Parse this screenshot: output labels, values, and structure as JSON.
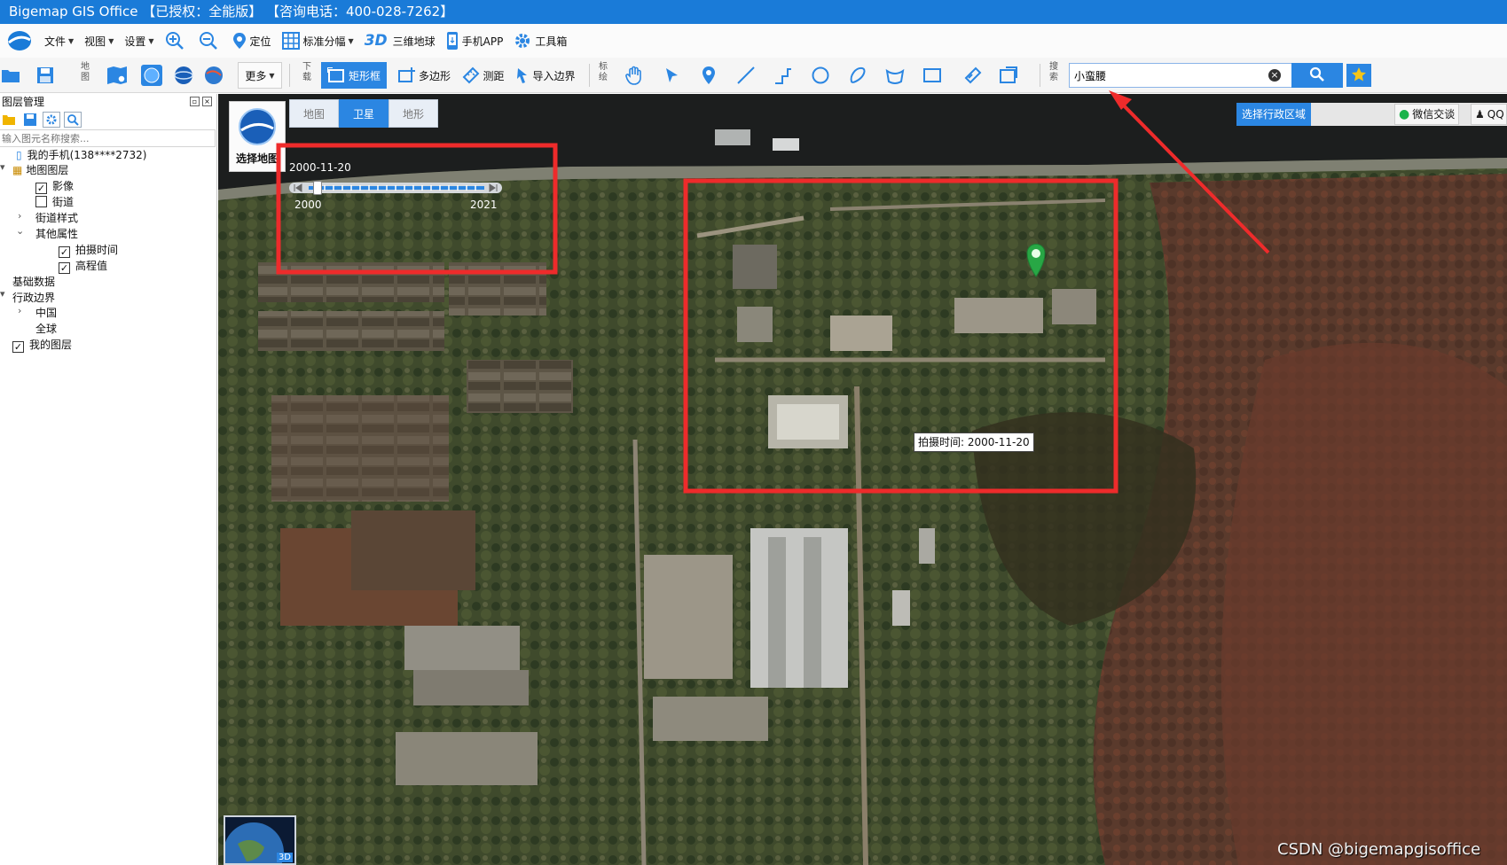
{
  "titlebar": {
    "title": "Bigemap GIS Office 【已授权：全能版】 【咨询电话：400-028-7262】"
  },
  "menu": {
    "file": "文件",
    "view": "视图",
    "settings": "设置",
    "locate": "定位",
    "std_sheet": "标准分幅",
    "three_d_badge": "3D",
    "globe_3d": "三维地球",
    "mobile_app": "手机APP",
    "toolbox": "工具箱"
  },
  "toolbar": {
    "map_group": [
      "地",
      "图"
    ],
    "more": "更多",
    "download_group": [
      "下",
      "载"
    ],
    "rect": "矩形框",
    "polygon": "多边形",
    "measure": "测距",
    "import_border": "导入边界",
    "mark_group": [
      "标",
      "绘"
    ],
    "search_group": [
      "搜",
      "索"
    ],
    "search_value": "小蛮腰"
  },
  "sidebar": {
    "title": "图层管理",
    "filter_placeholder": "输入图元名称搜索...",
    "tree": {
      "phone": "我的手机(138****2732)",
      "map_layers": "地图图层",
      "imagery": "影像",
      "imagery_checked": true,
      "streets": "街道",
      "streets_checked": false,
      "street_style": "街道样式",
      "other_props": "其他属性",
      "capture_time": "拍摄时间",
      "capture_time_checked": true,
      "elevation": "高程值",
      "elevation_checked": true,
      "base_data": "基础数据",
      "admin_border": "行政边界",
      "china": "中国",
      "global": "全球",
      "my_layers": "我的图层",
      "my_layers_checked": true
    }
  },
  "map": {
    "tabs": [
      "地图",
      "卫星",
      "地形"
    ],
    "active_tab": "卫星",
    "select_map": "选择地图",
    "timeline": {
      "date": "2000-11-20",
      "start": "2000",
      "end": "2021",
      "position": 0.05
    },
    "select_region": "选择行政区域",
    "wechat": "微信交谈",
    "qq": "QQ",
    "tooltip": "拍摄时间: 2000-11-20",
    "minimap_badge": "3D",
    "watermark": "CSDN @bigemapgisoffice"
  }
}
